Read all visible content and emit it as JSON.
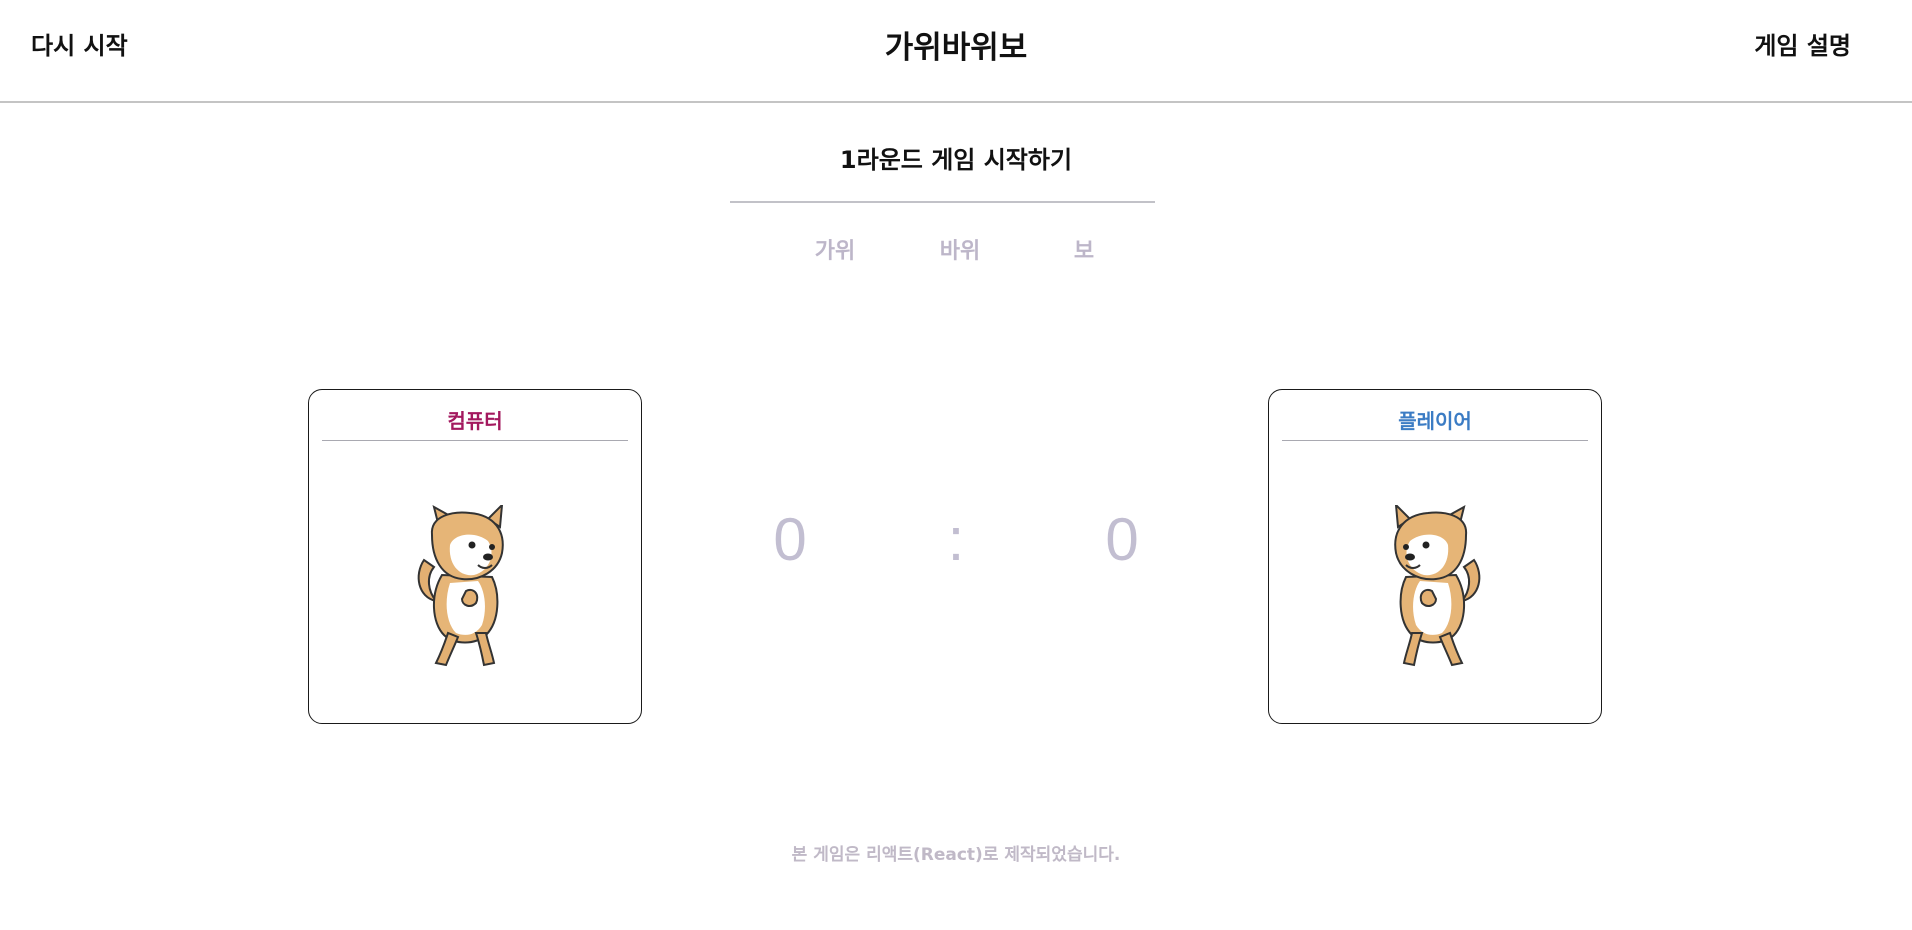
{
  "header": {
    "restart_label": "다시 시작",
    "title": "가위바위보",
    "help_label": "게임 설명"
  },
  "round": {
    "title": "1라운드 게임 시작하기"
  },
  "choices": [
    "가위",
    "바위",
    "보"
  ],
  "computer": {
    "label": "컴퓨터",
    "image": "shiba-dog"
  },
  "player": {
    "label": "플레이어",
    "image": "shiba-dog"
  },
  "score": {
    "computer": "0",
    "separator": ":",
    "player": "0"
  },
  "footer": {
    "text": "본 게임은 리액트(React)로 제작되었습니다."
  },
  "colors": {
    "computer_label": "#a3185e",
    "player_label": "#3b7cc4",
    "muted": "#c2bed1",
    "choice": "#bdb6c9"
  }
}
